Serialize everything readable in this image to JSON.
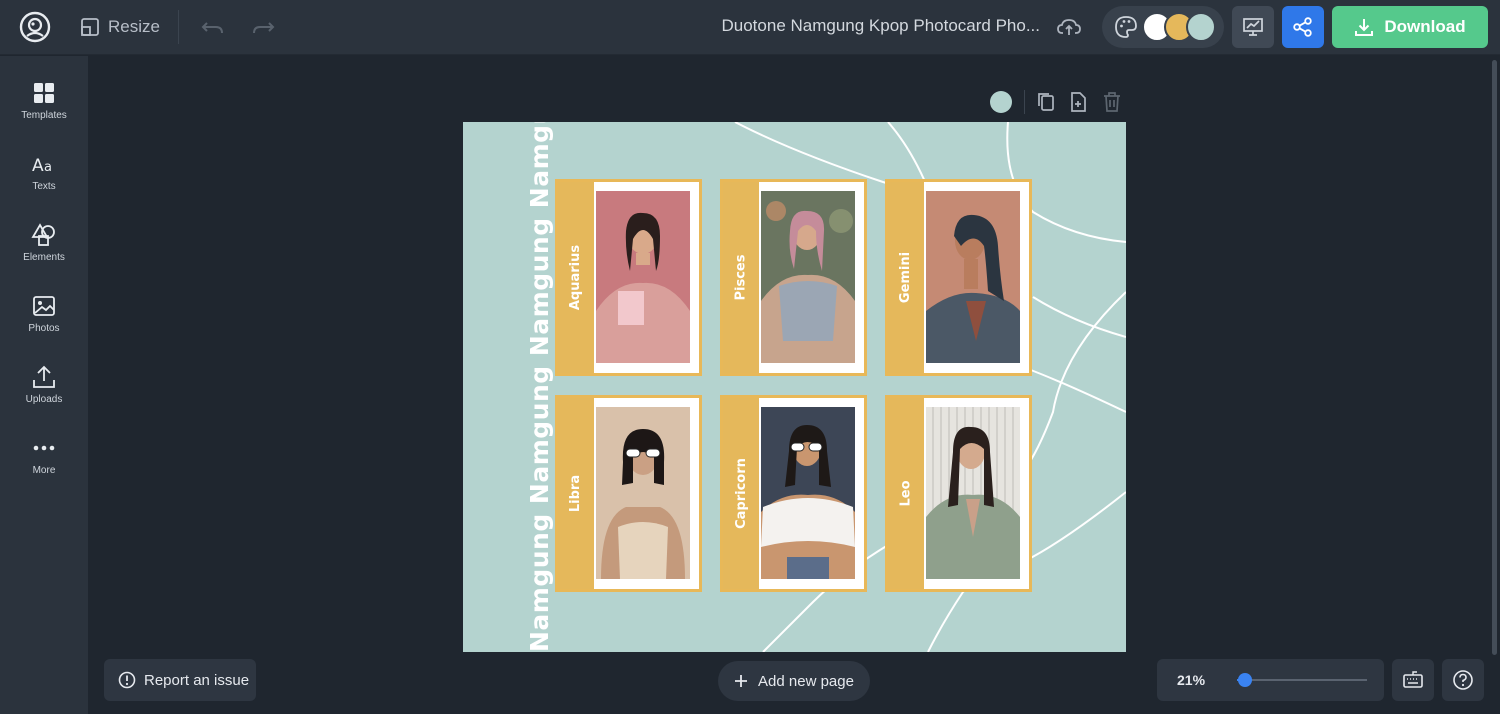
{
  "header": {
    "resize_label": "Resize",
    "doc_title": "Duotone Namgung Kpop Photocard Pho...",
    "download_label": "Download",
    "palette_swatches": [
      "#ffffff",
      "#e5b85b",
      "#b4d3cf"
    ]
  },
  "sidebar": {
    "items": [
      {
        "label": "Templates",
        "icon": "templates-icon"
      },
      {
        "label": "Texts",
        "icon": "text-icon"
      },
      {
        "label": "Elements",
        "icon": "elements-icon"
      },
      {
        "label": "Photos",
        "icon": "photos-icon"
      },
      {
        "label": "Uploads",
        "icon": "upload-icon"
      },
      {
        "label": "More",
        "icon": "more-icon"
      }
    ]
  },
  "design": {
    "background_color": "#b4d3cf",
    "accent_color": "#e5b85b",
    "vertical_text": "Namgung  Namgung  Namgung  Namgung",
    "cards": [
      {
        "sign": "Aquarius",
        "photo": "woman in pink hoodie holding notebook"
      },
      {
        "sign": "Pisces",
        "photo": "woman with pink hair in grey crop top"
      },
      {
        "sign": "Gemini",
        "photo": "woman in blazer, side profile"
      },
      {
        "sign": "Libra",
        "photo": "woman with bob and white cat-eye sunglasses"
      },
      {
        "sign": "Capricorn",
        "photo": "woman lowering white sunglasses"
      },
      {
        "sign": "Leo",
        "photo": "woman in sage shirt jacket"
      }
    ]
  },
  "footer": {
    "report_label": "Report an issue",
    "add_page_label": "Add new page",
    "zoom_label": "21%",
    "zoom_fraction": 0.21
  }
}
